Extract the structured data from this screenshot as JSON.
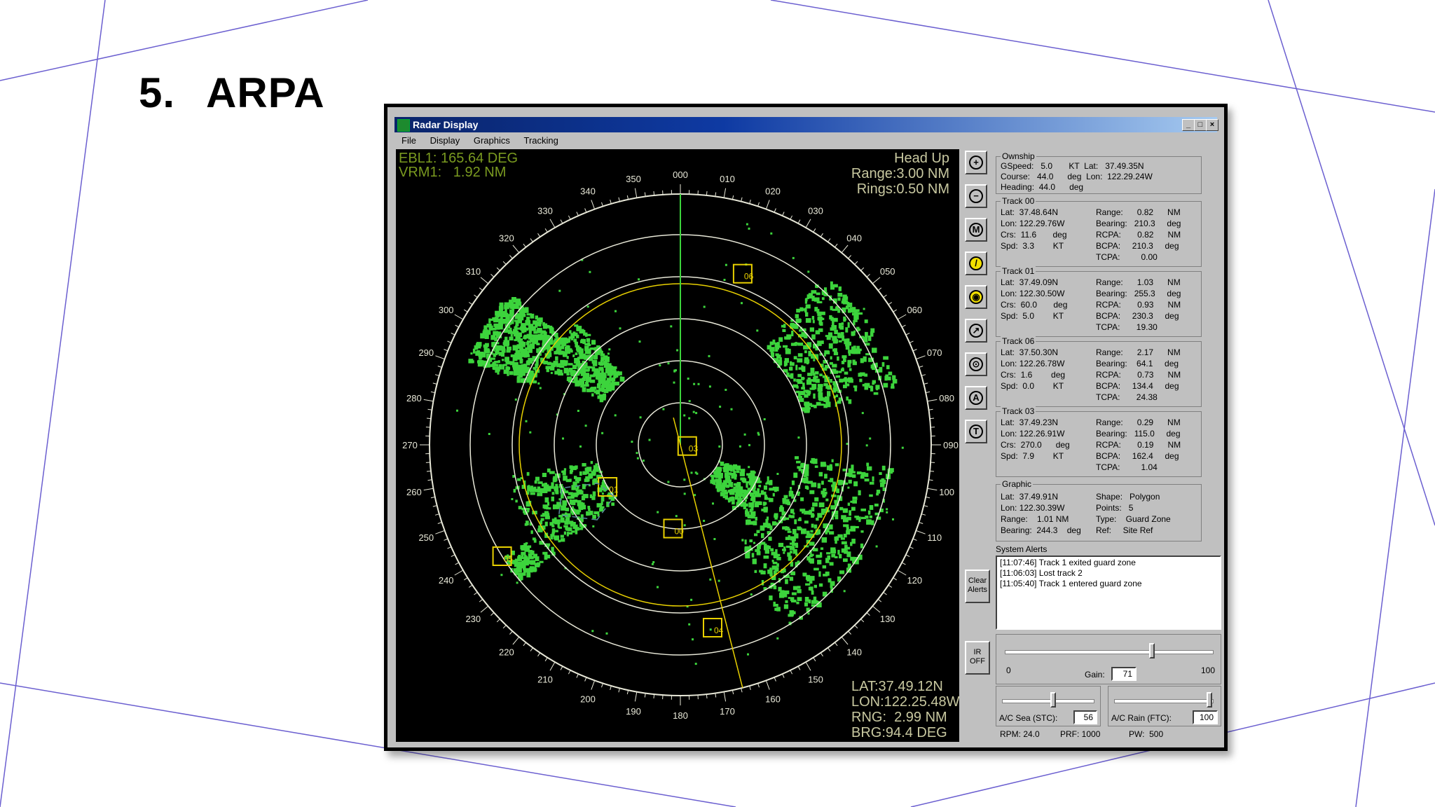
{
  "slide": {
    "number": "5.",
    "title": "ARPA"
  },
  "window": {
    "title": "Radar Display",
    "buttons": {
      "minimize": "_",
      "maximize": "□",
      "close": "×"
    }
  },
  "menu": [
    "File",
    "Display",
    "Graphics",
    "Tracking"
  ],
  "radar": {
    "ebl": "EBL1: 165.64 DEG",
    "vrm": "VRM1:   1.92 NM",
    "mode": "Head Up",
    "range": "Range:3.00 NM",
    "rings": "Rings:0.50 NM",
    "cursor_lat": "LAT:37.49.12N",
    "cursor_lon": "LON:122.25.48W",
    "cursor_rng": "RNG:  2.99 NM",
    "cursor_brg": "BRG:94.4 DEG",
    "bearing_labels": [
      "000",
      "010",
      "020",
      "030",
      "040",
      "050",
      "060",
      "070",
      "080",
      "090",
      "100",
      "110",
      "120",
      "130",
      "140",
      "150",
      "160",
      "170",
      "180",
      "190",
      "200",
      "210",
      "220",
      "230",
      "240",
      "250",
      "260",
      "270",
      "280",
      "290",
      "300",
      "310",
      "320",
      "330",
      "340",
      "350"
    ],
    "track_labels": [
      "06",
      "03",
      "01",
      "00",
      "05",
      "04"
    ],
    "colors": {
      "echo": "#3cd43c",
      "rings": "#e8e8d8",
      "yellow": "#e8d000"
    }
  },
  "tools": [
    "plus-icon",
    "minus-icon",
    "m-icon",
    "compass-icon",
    "target-icon",
    "arrow-icon",
    "center-icon",
    "a-icon",
    "t-icon"
  ],
  "tool_letters": [
    "+",
    "−",
    "M",
    "/",
    "◉",
    "↗",
    "⊙",
    "A",
    "T"
  ],
  "side_buttons": {
    "clear_alerts": "Clear\nAlerts",
    "ir_off": "IR\nOFF"
  },
  "ownship": {
    "title": "Ownship",
    "rows": [
      "GSpeed:   5.0       KT  Lat:   37.49.35N",
      "Course:   44.0      deg  Lon:  122.29.24W",
      "Heading:  44.0      deg"
    ]
  },
  "tracks": [
    {
      "title": "Track 00",
      "left": [
        "Lat:  37.48.64N",
        "Lon: 122.29.76W",
        "Crs:  11.6       deg",
        "Spd:  3.3        KT"
      ],
      "right": [
        "Range:      0.82      NM",
        "Bearing:   210.3     deg",
        "RCPA:       0.82      NM",
        "BCPA:     210.3     deg",
        "TCPA:         0.00"
      ]
    },
    {
      "title": "Track 01",
      "left": [
        "Lat:  37.49.09N",
        "Lon: 122.30.50W",
        "Crs:  60.0       deg",
        "Spd:  5.0        KT"
      ],
      "right": [
        "Range:      1.03      NM",
        "Bearing:   255.3     deg",
        "RCPA:       0.93      NM",
        "BCPA:     230.3     deg",
        "TCPA:       19.30"
      ]
    },
    {
      "title": "Track 06",
      "left": [
        "Lat:  37.50.30N",
        "Lon: 122.26.78W",
        "Crs:  1.6        deg",
        "Spd:  0.0        KT"
      ],
      "right": [
        "Range:      2.17      NM",
        "Bearing:    64.1     deg",
        "RCPA:       0.73      NM",
        "BCPA:     134.4     deg",
        "TCPA:       24.38"
      ]
    },
    {
      "title": "Track 03",
      "left": [
        "Lat:  37.49.23N",
        "Lon: 122.26.91W",
        "Crs:  270.0      deg",
        "Spd:  7.9        KT"
      ],
      "right": [
        "Range:      0.29      NM",
        "Bearing:   115.0     deg",
        "RCPA:       0.19      NM",
        "BCPA:     162.4     deg",
        "TCPA:         1.04"
      ]
    }
  ],
  "graphic": {
    "title": "Graphic",
    "left": [
      "Lat:  37.49.91N",
      "Lon: 122.30.39W",
      "Range:    1.01 NM",
      "Bearing:  244.3    deg"
    ],
    "right": [
      "Shape:   Polygon",
      "Points:   5",
      "Type:    Guard Zone",
      "Ref:     Site Ref"
    ]
  },
  "alerts": {
    "title": "System Alerts",
    "items": [
      "[11:07:46] Track 1 exited guard zone",
      "[11:06:03] Lost track 2",
      "[11:05:40] Track 1 entered guard zone"
    ]
  },
  "gain": {
    "min": "0",
    "max": "100",
    "label": "Gain:",
    "value": "71",
    "level": 0.71
  },
  "sea": {
    "label": "A/C Sea (STC):",
    "value": "56",
    "level": 0.56
  },
  "rain": {
    "label": "A/C Rain (FTC):",
    "value": "100",
    "level": 1.0
  },
  "status": {
    "rpm": "RPM: 24.0",
    "prf": "PRF: 1000",
    "pw": "PW:  500"
  }
}
